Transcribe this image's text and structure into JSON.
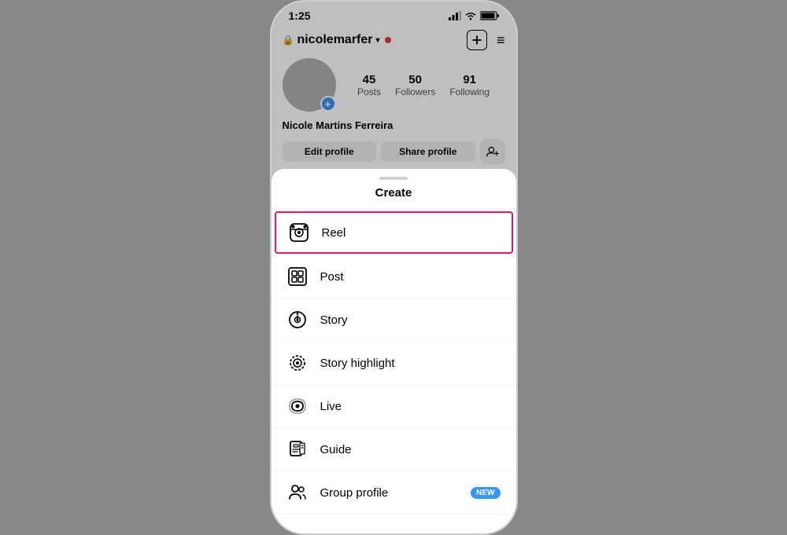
{
  "statusBar": {
    "time": "1:25",
    "icons": [
      "signal",
      "wifi",
      "battery"
    ]
  },
  "profile": {
    "username": "nicolemarfer",
    "stats": [
      {
        "value": "45",
        "label": "Posts"
      },
      {
        "value": "50",
        "label": "Followers"
      },
      {
        "value": "91",
        "label": "Following"
      }
    ],
    "name": "Nicole Martins Ferreira",
    "buttons": {
      "editProfile": "Edit profile",
      "shareProfile": "Share profile"
    }
  },
  "sheet": {
    "title": "Create",
    "items": [
      {
        "id": "reel",
        "label": "Reel",
        "highlighted": true,
        "badge": null
      },
      {
        "id": "post",
        "label": "Post",
        "highlighted": false,
        "badge": null
      },
      {
        "id": "story",
        "label": "Story",
        "highlighted": false,
        "badge": null
      },
      {
        "id": "story-highlight",
        "label": "Story highlight",
        "highlighted": false,
        "badge": null
      },
      {
        "id": "live",
        "label": "Live",
        "highlighted": false,
        "badge": null
      },
      {
        "id": "guide",
        "label": "Guide",
        "highlighted": false,
        "badge": null
      },
      {
        "id": "group-profile",
        "label": "Group profile",
        "highlighted": false,
        "badge": "NEW"
      }
    ]
  }
}
